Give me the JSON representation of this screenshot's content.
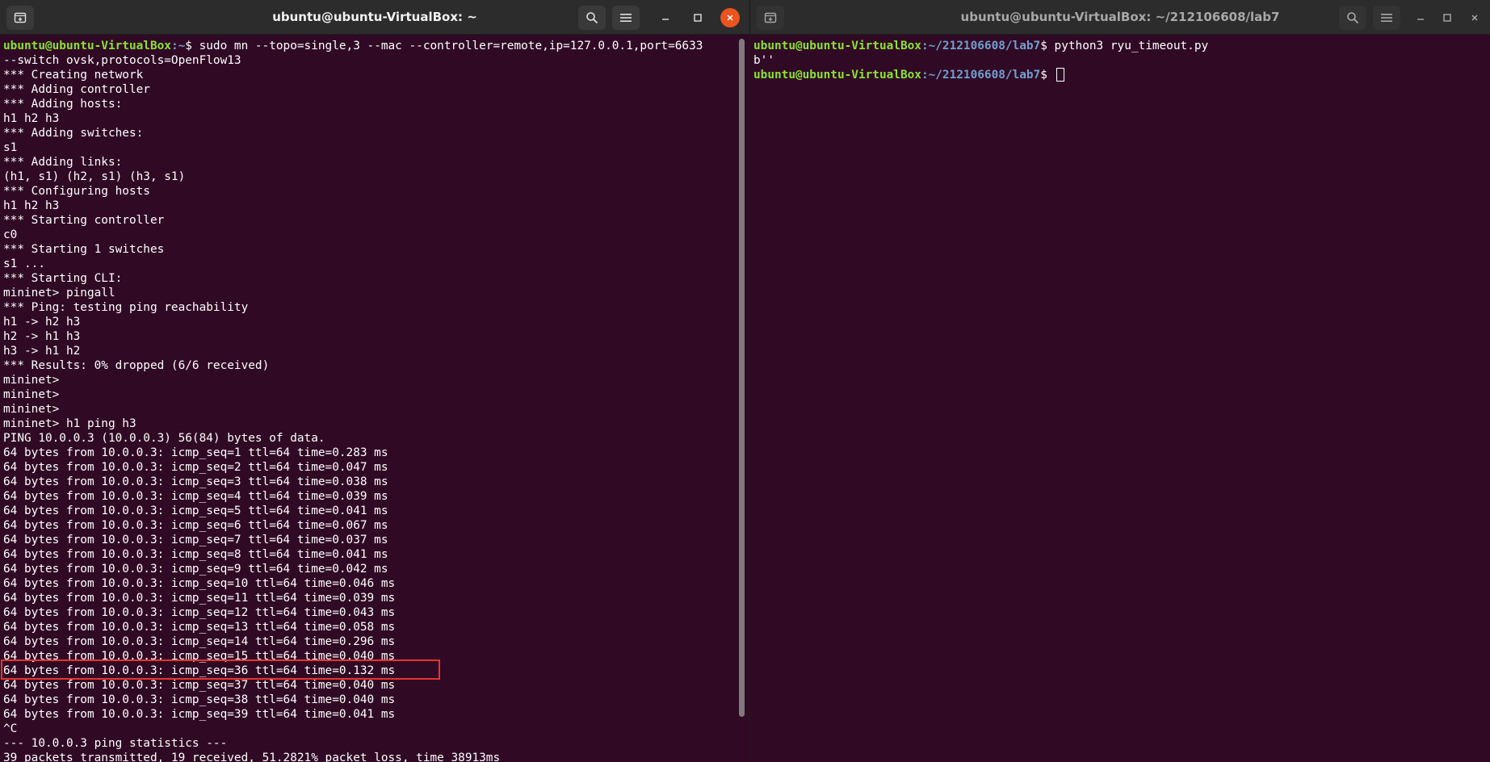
{
  "left_window": {
    "title": "ubuntu@ubuntu-VirtualBox: ~",
    "lines": [
      {
        "user": "ubuntu@ubuntu-VirtualBox",
        "path": ":~",
        "cmd": "$ sudo mn --topo=single,3 --mac --controller=remote,ip=127.0.0.1,port=6633"
      },
      {
        "text": "--switch ovsk,protocols=OpenFlow13"
      },
      {
        "text": "*** Creating network"
      },
      {
        "text": "*** Adding controller"
      },
      {
        "text": "*** Adding hosts:"
      },
      {
        "text": "h1 h2 h3"
      },
      {
        "text": "*** Adding switches:"
      },
      {
        "text": "s1"
      },
      {
        "text": "*** Adding links:"
      },
      {
        "text": "(h1, s1) (h2, s1) (h3, s1)"
      },
      {
        "text": "*** Configuring hosts"
      },
      {
        "text": "h1 h2 h3"
      },
      {
        "text": "*** Starting controller"
      },
      {
        "text": "c0"
      },
      {
        "text": "*** Starting 1 switches"
      },
      {
        "text": "s1 ..."
      },
      {
        "text": "*** Starting CLI:"
      },
      {
        "text": "mininet> pingall"
      },
      {
        "text": "*** Ping: testing ping reachability"
      },
      {
        "text": "h1 -> h2 h3"
      },
      {
        "text": "h2 -> h1 h3"
      },
      {
        "text": "h3 -> h1 h2"
      },
      {
        "text": "*** Results: 0% dropped (6/6 received)"
      },
      {
        "text": "mininet>"
      },
      {
        "text": "mininet>"
      },
      {
        "text": "mininet>"
      },
      {
        "text": "mininet> h1 ping h3"
      },
      {
        "text": "PING 10.0.0.3 (10.0.0.3) 56(84) bytes of data."
      },
      {
        "text": "64 bytes from 10.0.0.3: icmp_seq=1 ttl=64 time=0.283 ms"
      },
      {
        "text": "64 bytes from 10.0.0.3: icmp_seq=2 ttl=64 time=0.047 ms"
      },
      {
        "text": "64 bytes from 10.0.0.3: icmp_seq=3 ttl=64 time=0.038 ms"
      },
      {
        "text": "64 bytes from 10.0.0.3: icmp_seq=4 ttl=64 time=0.039 ms"
      },
      {
        "text": "64 bytes from 10.0.0.3: icmp_seq=5 ttl=64 time=0.041 ms"
      },
      {
        "text": "64 bytes from 10.0.0.3: icmp_seq=6 ttl=64 time=0.067 ms"
      },
      {
        "text": "64 bytes from 10.0.0.3: icmp_seq=7 ttl=64 time=0.037 ms"
      },
      {
        "text": "64 bytes from 10.0.0.3: icmp_seq=8 ttl=64 time=0.041 ms"
      },
      {
        "text": "64 bytes from 10.0.0.3: icmp_seq=9 ttl=64 time=0.042 ms"
      },
      {
        "text": "64 bytes from 10.0.0.3: icmp_seq=10 ttl=64 time=0.046 ms"
      },
      {
        "text": "64 bytes from 10.0.0.3: icmp_seq=11 ttl=64 time=0.039 ms"
      },
      {
        "text": "64 bytes from 10.0.0.3: icmp_seq=12 ttl=64 time=0.043 ms"
      },
      {
        "text": "64 bytes from 10.0.0.3: icmp_seq=13 ttl=64 time=0.058 ms"
      },
      {
        "text": "64 bytes from 10.0.0.3: icmp_seq=14 ttl=64 time=0.296 ms"
      },
      {
        "text": "64 bytes from 10.0.0.3: icmp_seq=15 ttl=64 time=0.040 ms"
      },
      {
        "text": "64 bytes from 10.0.0.3: icmp_seq=36 ttl=64 time=0.132 ms",
        "highlighted": true
      },
      {
        "text": "64 bytes from 10.0.0.3: icmp_seq=37 ttl=64 time=0.040 ms"
      },
      {
        "text": "64 bytes from 10.0.0.3: icmp_seq=38 ttl=64 time=0.040 ms"
      },
      {
        "text": "64 bytes from 10.0.0.3: icmp_seq=39 ttl=64 time=0.041 ms"
      },
      {
        "text": "^C"
      },
      {
        "text": "--- 10.0.0.3 ping statistics ---"
      },
      {
        "text": "39 packets transmitted, 19 received, 51.2821% packet loss, time 38913ms"
      }
    ]
  },
  "right_window": {
    "title": "ubuntu@ubuntu-VirtualBox: ~/212106608/lab7",
    "lines": [
      {
        "user": "ubuntu@ubuntu-VirtualBox",
        "path": ":~/212106608/lab7",
        "cmd": "$ python3 ryu_timeout.py"
      },
      {
        "text": "b''"
      },
      {
        "user": "ubuntu@ubuntu-VirtualBox",
        "path": ":~/212106608/lab7",
        "cmd": "$ ",
        "cursor": true
      }
    ]
  },
  "icons": {
    "new_tab": "new-tab-icon",
    "search": "search-icon",
    "menu": "hamburger-menu-icon",
    "minimize": "minimize-icon",
    "maximize": "maximize-icon",
    "close": "close-icon"
  },
  "colors": {
    "terminal_bg": "#300a24",
    "prompt_user": "#8ae234",
    "prompt_path": "#729fcf",
    "highlight_box": "#e8342e",
    "close_button": "#e9541f"
  }
}
